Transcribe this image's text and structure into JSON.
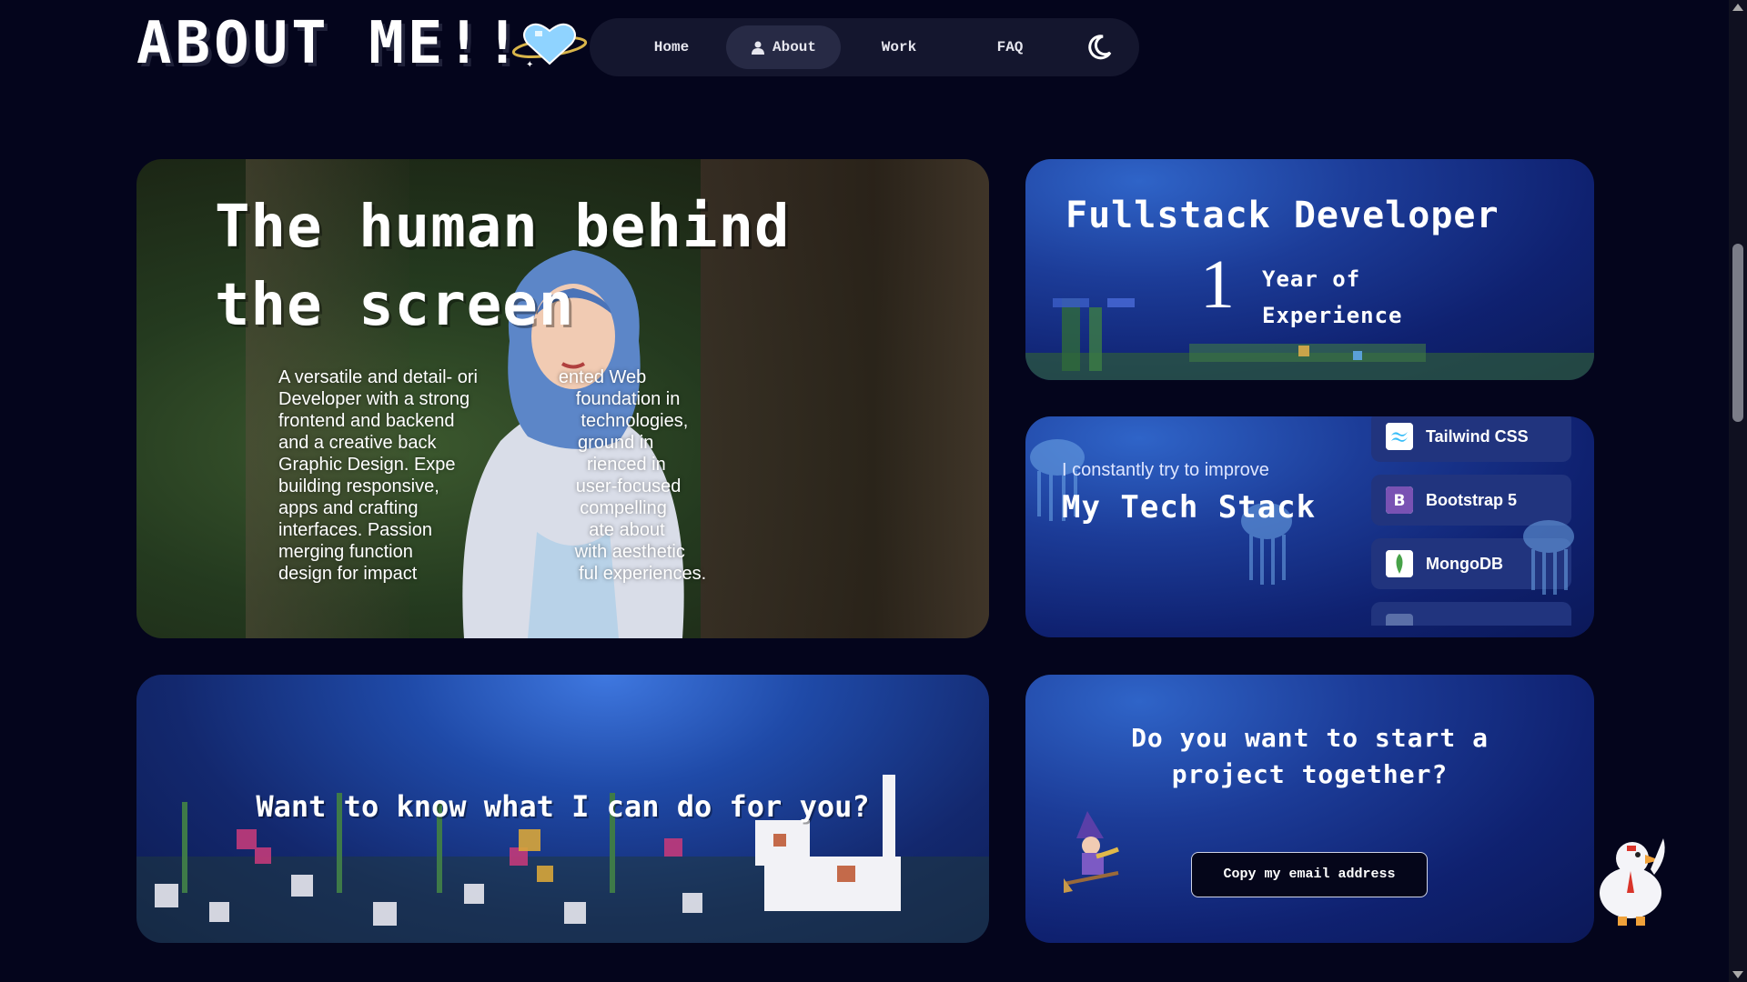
{
  "header": {
    "title": "ABOUT ME!!",
    "nav": [
      {
        "label": "Home"
      },
      {
        "label": "About",
        "active": true
      },
      {
        "label": "Work"
      },
      {
        "label": "FAQ"
      }
    ],
    "theme_toggle_icon": "moon-icon"
  },
  "intro": {
    "heading": "The human behind the screen",
    "lines": [
      "A versatile and detail- ori                ented Web",
      "Developer with a strong                     foundation in",
      "frontend and backend                         technologies,",
      "and a creative back                            ground in",
      "Graphic Design. Expe                          rienced in",
      "building responsive,                           user-focused",
      "apps and crafting                                compelling",
      "interfaces. Passion                               ate about",
      "merging function                                with aesthetic",
      "design for impact                                ful experiences."
    ]
  },
  "experience": {
    "title": "Fullstack Developer",
    "years": "1",
    "label_line1": "Year of",
    "label_line2": "Experience"
  },
  "stack": {
    "subtitle": "I constantly try to improve",
    "title": "My Tech Stack",
    "items": [
      {
        "name": "Tailwind CSS",
        "icon": "tailwind-icon",
        "color": "#38bdf8"
      },
      {
        "name": "Bootstrap 5",
        "icon": "bootstrap-icon",
        "color": "#7952b3"
      },
      {
        "name": "MongoDB",
        "icon": "mongodb-icon",
        "color": "#47a248"
      },
      {
        "name": "",
        "icon": "tech-icon",
        "color": "#5a6fa8"
      }
    ]
  },
  "services": {
    "prompt": "Want to know what I can do for you?"
  },
  "project": {
    "title_line1": "Do you want to start a",
    "title_line2": "project together?",
    "button": "Copy my email address"
  },
  "colors": {
    "background": "#04051c",
    "card_blue": "#1c3c98",
    "nav_bg": "#14162e"
  }
}
